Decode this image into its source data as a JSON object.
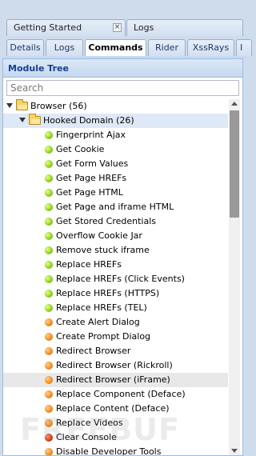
{
  "top_tabs": [
    {
      "label": "Getting Started",
      "closable": true
    },
    {
      "label": "Logs"
    }
  ],
  "sub_tabs": [
    {
      "label": "Details"
    },
    {
      "label": "Logs"
    },
    {
      "label": "Commands",
      "active": true
    },
    {
      "label": "Rider"
    },
    {
      "label": "XssRays"
    },
    {
      "label": "I"
    }
  ],
  "panel": {
    "title": "Module Tree",
    "search_placeholder": "Search"
  },
  "tree": {
    "root": {
      "label": "Browser (56)"
    },
    "group": {
      "label": "Hooked Domain (26)"
    },
    "items": [
      {
        "label": "Fingerprint Ajax",
        "status": "green"
      },
      {
        "label": "Get Cookie",
        "status": "green"
      },
      {
        "label": "Get Form Values",
        "status": "green"
      },
      {
        "label": "Get Page HREFs",
        "status": "green"
      },
      {
        "label": "Get Page HTML",
        "status": "green"
      },
      {
        "label": "Get Page and iframe HTML",
        "status": "green"
      },
      {
        "label": "Get Stored Credentials",
        "status": "green"
      },
      {
        "label": "Overflow Cookie Jar",
        "status": "green"
      },
      {
        "label": "Remove stuck iframe",
        "status": "green"
      },
      {
        "label": "Replace HREFs",
        "status": "green"
      },
      {
        "label": "Replace HREFs (Click Events)",
        "status": "green"
      },
      {
        "label": "Replace HREFs (HTTPS)",
        "status": "green"
      },
      {
        "label": "Replace HREFs (TEL)",
        "status": "green"
      },
      {
        "label": "Create Alert Dialog",
        "status": "orange"
      },
      {
        "label": "Create Prompt Dialog",
        "status": "orange"
      },
      {
        "label": "Redirect Browser",
        "status": "orange"
      },
      {
        "label": "Redirect Browser (Rickroll)",
        "status": "orange"
      },
      {
        "label": "Redirect Browser (iFrame)",
        "status": "orange",
        "selected": true
      },
      {
        "label": "Replace Component (Deface)",
        "status": "orange"
      },
      {
        "label": "Replace Content (Deface)",
        "status": "orange"
      },
      {
        "label": "Replace Videos",
        "status": "orange"
      },
      {
        "label": "Clear Console",
        "status": "red"
      },
      {
        "label": "Disable Developer Tools",
        "status": "orange"
      }
    ]
  },
  "watermark": "FREEBUF",
  "colors": {
    "panel_header_text": "#15428b",
    "status_green": "#8ccf1d",
    "status_orange": "#f28b1d",
    "status_red": "#d83a12"
  }
}
